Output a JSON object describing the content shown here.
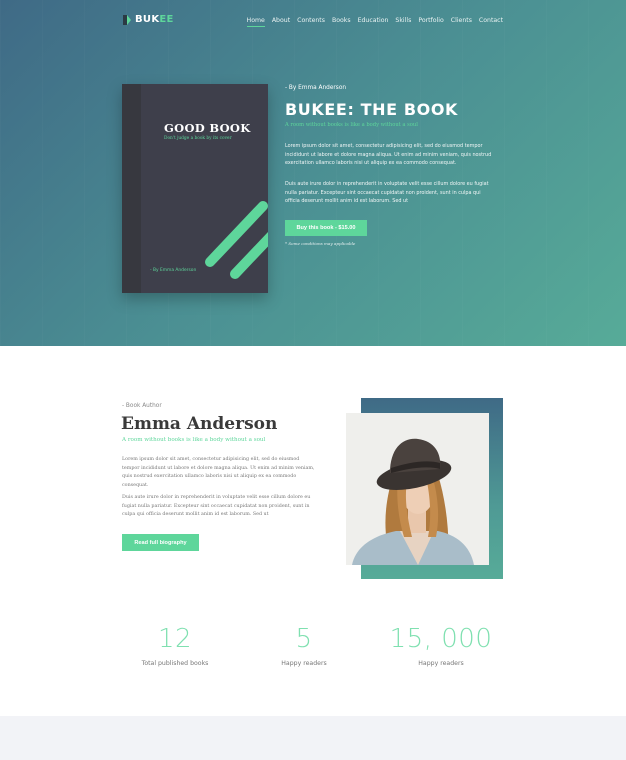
{
  "brand": {
    "prefix": "BUK",
    "accent": "EE",
    "accent_color": "#5ed69b"
  },
  "nav": {
    "items": [
      {
        "label": "Home",
        "active": true
      },
      {
        "label": "About"
      },
      {
        "label": "Contents"
      },
      {
        "label": "Books"
      },
      {
        "label": "Education"
      },
      {
        "label": "Skills"
      },
      {
        "label": "Portfolio"
      },
      {
        "label": "Clients"
      },
      {
        "label": "Contact"
      }
    ]
  },
  "book_cover": {
    "title": "GOOD BOOK",
    "tagline": "Don't judge a book by its cover",
    "author": "- By Emma Anderson"
  },
  "hero": {
    "byline": "- By Emma Anderson",
    "title": "BUKEE: THE BOOK",
    "subtitle": "A room without books is like a body without a soul",
    "paragraph1": "Lorem ipsum dolor sit amet, consectetur adipisicing elit, sed do eiusmod tempor incididunt ut labore et dolore magna aliqua. Ut enim ad minim veniam, quis nostrud exercitation ullamco laboris nisi ut aliquip ex ea commodo consequat.",
    "paragraph2": "Duis aute irure dolor in reprehenderit in voluptate velit esse cillum dolore eu fugiat nulla pariatur. Excepteur sint occaecat cupidatat non proident, sunt in culpa qui officia deserunt mollit anim id est laborum. Sed ut",
    "buy_button": "Buy this book - $15.00",
    "note": "* Some conditions may applicable"
  },
  "author": {
    "label": "- Book Author",
    "name": "Emma Anderson",
    "subtitle": "A room without books is like a body without a soul",
    "paragraph1": "Lorem ipsum dolor sit amet, consectetur adipisicing elit, sed do eiusmod tempor incididunt ut labore et dolore magna aliqua. Ut enim ad minim veniam, quis nostrud exercitation ullamco laboris nisi ut aliquip ex ea commodo consequat.",
    "paragraph2": "Duis aute irure dolor in reprehenderit in voluptate velit esse cillum dolore eu fugiat nulla pariatur. Excepteur sint occaecat cupidatat non proident, sunt in culpa qui officia deserunt mollit anim id est laborum. Sed ut",
    "bio_button": "Read full biography"
  },
  "stats": [
    {
      "value": "12",
      "label": "Total published books"
    },
    {
      "value": "5",
      "label": "Happy readers"
    },
    {
      "value": "15, 000",
      "label": "Happy readers"
    }
  ],
  "colors": {
    "accent": "#5ed69b",
    "hero_gradient_start": "#3f6a86",
    "hero_gradient_end": "#57ab98",
    "book_cover": "#3e3f4b"
  }
}
